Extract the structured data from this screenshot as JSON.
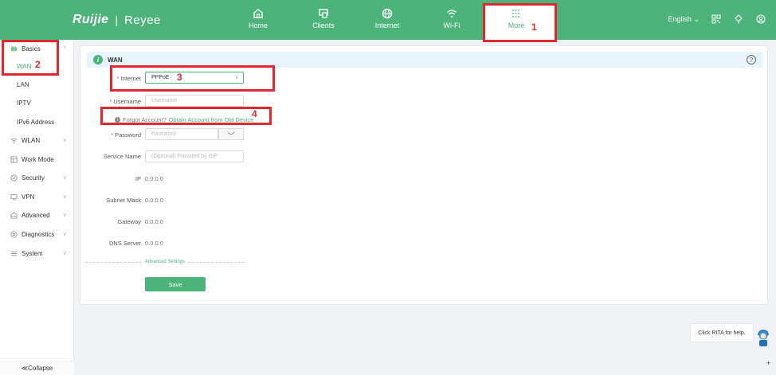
{
  "header": {
    "brand_primary": "Ruijie",
    "brand_separator": "|",
    "brand_secondary": "Reyee",
    "nav": [
      {
        "label": "Home",
        "icon": "home-icon"
      },
      {
        "label": "Clients",
        "icon": "clients-icon"
      },
      {
        "label": "Internet",
        "icon": "globe-icon"
      },
      {
        "label": "Wi-Fi",
        "icon": "wifi-icon"
      },
      {
        "label": "More",
        "icon": "more-icon"
      }
    ],
    "language": "English",
    "language_chevron": "⌄"
  },
  "sidebar": {
    "groups": [
      {
        "label": "Basics",
        "icon": "globe-icon"
      },
      {
        "label": "WLAN",
        "icon": "wifi-icon"
      },
      {
        "label": "Work Mode",
        "icon": "workmode-icon"
      },
      {
        "label": "Security",
        "icon": "shield-icon"
      },
      {
        "label": "VPN",
        "icon": "vpn-icon"
      },
      {
        "label": "Advanced",
        "icon": "advanced-icon"
      },
      {
        "label": "Diagnostics",
        "icon": "diagnostics-icon"
      },
      {
        "label": "System",
        "icon": "system-icon"
      }
    ],
    "basics_items": [
      "WAN",
      "LAN",
      "IPTV",
      "IPv6 Address"
    ],
    "collapse_label": "≪Collapse"
  },
  "form": {
    "title": "WAN",
    "internet_label": "Internet",
    "internet_value": "PPPoE",
    "username_label": "Username",
    "username_placeholder": "Username",
    "forgot_text": "Forgot Account?",
    "forgot_link": "Obtain Account from Old Device",
    "password_label": "Password",
    "password_placeholder": "Password",
    "service_name_label": "Service Name",
    "service_name_placeholder": "(Optional) Provided by ISP",
    "ip_label": "IP",
    "ip_value": "0.0.0.0",
    "subnet_label": "Subnet Mask",
    "subnet_value": "0.0.0.0",
    "gateway_label": "Gateway",
    "gateway_value": "0.0.0.0",
    "dns_label": "DNS Server",
    "dns_value": "0.0.0.0",
    "advanced_label": "Advanced Settings",
    "save_label": "Save"
  },
  "annotations": [
    "1",
    "2",
    "3",
    "4"
  ],
  "rita": {
    "text": "Click RITA for help."
  },
  "colors": {
    "brand_green": "#4cb37b",
    "annotation_red": "#e0282e"
  }
}
